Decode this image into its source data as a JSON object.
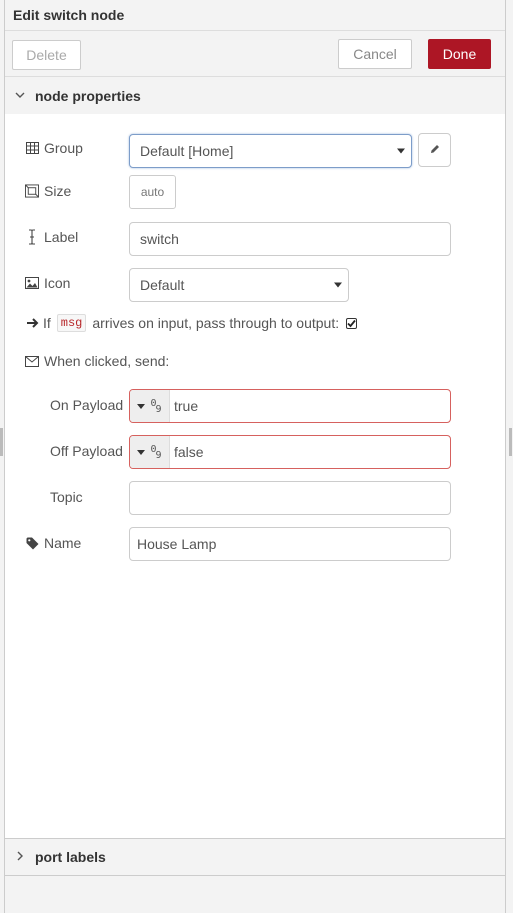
{
  "header": {
    "title": "Edit switch node",
    "delete_label": "Delete",
    "cancel_label": "Cancel",
    "done_label": "Done"
  },
  "sections": {
    "node_properties": "node properties",
    "port_labels": "port labels"
  },
  "form": {
    "group": {
      "label": "Group",
      "value": "Default [Home]"
    },
    "size": {
      "label": "Size",
      "value": "auto"
    },
    "label": {
      "label": "Label",
      "value": "switch"
    },
    "icon": {
      "label": "Icon",
      "value": "Default"
    },
    "passthrough": {
      "prefix": "If",
      "code": "msg",
      "suffix": "arrives on input, pass through to output:",
      "checked": true
    },
    "when_clicked": "When clicked, send:",
    "on_payload": {
      "label": "On Payload",
      "value": "true"
    },
    "off_payload": {
      "label": "Off Payload",
      "value": "false"
    },
    "topic": {
      "label": "Topic",
      "value": ""
    },
    "name": {
      "label": "Name",
      "value": "House Lamp"
    }
  },
  "colors": {
    "done": "#ad1625",
    "error_border": "#d6615e",
    "focus_border": "#7d9dc9"
  },
  "icons": [
    "table-icon",
    "size-icon",
    "text-cursor-icon",
    "image-icon",
    "arrow-right-icon",
    "envelope-icon",
    "tag-icon",
    "pencil-icon",
    "chevron-down-icon",
    "chevron-right-icon"
  ]
}
